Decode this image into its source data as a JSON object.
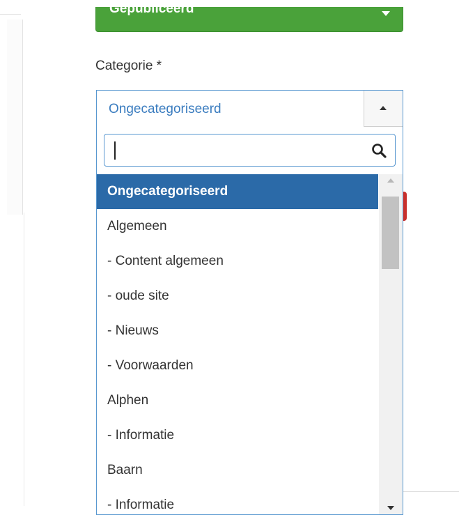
{
  "status": {
    "value": "Gepubliceerd"
  },
  "category": {
    "label": "Categorie *",
    "selected": "Ongecategoriseerd",
    "search": {
      "value": "",
      "placeholder": ""
    },
    "options": [
      "Ongecategoriseerd",
      "Algemeen",
      "- Content algemeen",
      "- oude site",
      "- Nieuws",
      "- Voorwaarden",
      "Alphen",
      "- Informatie",
      "Baarn",
      "- Informatie"
    ],
    "highlighted_index": 0
  },
  "colors": {
    "status_green": "#4aa23a",
    "highlight_blue": "#2b6aa8",
    "focus_border": "#5897d0",
    "selected_text": "#3a7cbf"
  },
  "icons": {
    "status_dropdown": "caret-down-icon",
    "chosen_toggle": "caret-up-icon",
    "search": "search-icon"
  }
}
